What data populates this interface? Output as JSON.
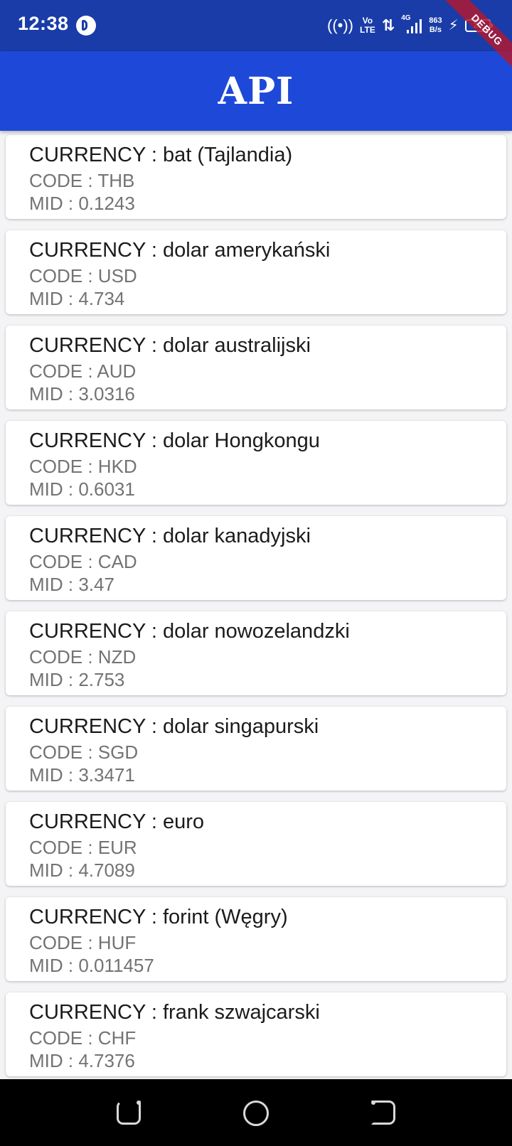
{
  "status_bar": {
    "time": "12:38",
    "volte_top": "Vo",
    "volte_bottom": "LTE",
    "network_type": "4G",
    "speed_value": "863",
    "speed_unit": "B/s",
    "battery_level": "29"
  },
  "debug_banner": {
    "label": "DEBUG"
  },
  "app_bar": {
    "title": "API"
  },
  "currencies": [
    {
      "currency": "CURRENCY : bat (Tajlandia)",
      "code": "CODE : THB",
      "mid": "MID : 0.1243"
    },
    {
      "currency": "CURRENCY : dolar amerykański",
      "code": "CODE : USD",
      "mid": "MID : 4.734"
    },
    {
      "currency": "CURRENCY : dolar australijski",
      "code": "CODE : AUD",
      "mid": "MID : 3.0316"
    },
    {
      "currency": "CURRENCY : dolar Hongkongu",
      "code": "CODE : HKD",
      "mid": "MID : 0.6031"
    },
    {
      "currency": "CURRENCY : dolar kanadyjski",
      "code": "CODE : CAD",
      "mid": "MID : 3.47"
    },
    {
      "currency": "CURRENCY : dolar nowozelandzki",
      "code": "CODE : NZD",
      "mid": "MID : 2.753"
    },
    {
      "currency": "CURRENCY : dolar singapurski",
      "code": "CODE : SGD",
      "mid": "MID : 3.3471"
    },
    {
      "currency": "CURRENCY : euro",
      "code": "CODE : EUR",
      "mid": "MID : 4.7089"
    },
    {
      "currency": "CURRENCY : forint (Węgry)",
      "code": "CODE : HUF",
      "mid": "MID : 0.011457"
    },
    {
      "currency": "CURRENCY : frank szwajcarski",
      "code": "CODE : CHF",
      "mid": "MID : 4.7376"
    }
  ],
  "colors": {
    "status_bar": "#1a3ca8",
    "app_bar": "#1e49d8",
    "background": "#f4f4f6",
    "card": "#ffffff",
    "primary_text": "#1b1b1b",
    "secondary_text": "#737373",
    "debug_banner": "#af1932"
  },
  "icons": {
    "hotspot": "hotspot-icon",
    "data_arrows": "data-arrows-icon",
    "signal": "signal-icon",
    "charging": "charging-icon",
    "battery": "battery-icon",
    "nav_recents": "recents-icon",
    "nav_home": "home-icon",
    "nav_back": "back-icon"
  }
}
